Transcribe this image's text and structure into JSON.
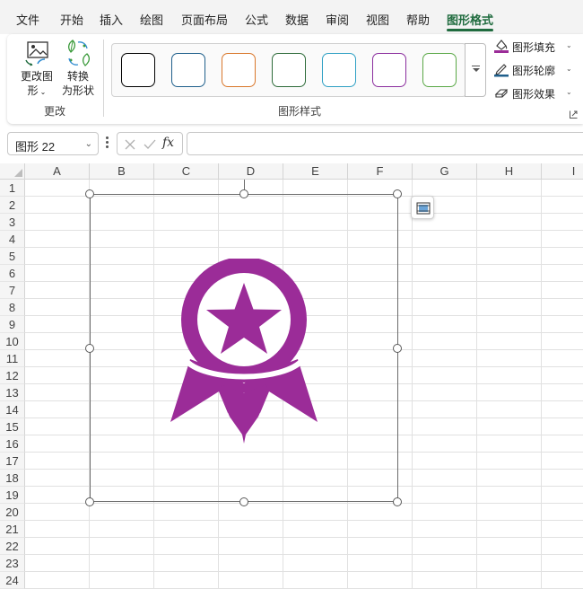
{
  "menu": {
    "tabs": [
      {
        "label": "文件"
      },
      {
        "label": "开始"
      },
      {
        "label": "插入"
      },
      {
        "label": "绘图"
      },
      {
        "label": "页面布局"
      },
      {
        "label": "公式"
      },
      {
        "label": "数据"
      },
      {
        "label": "审阅"
      },
      {
        "label": "视图"
      },
      {
        "label": "帮助"
      },
      {
        "label": "图形格式"
      }
    ],
    "active_tab": "图形格式",
    "accent_color": "#1f6b3e"
  },
  "ribbon": {
    "change_group": {
      "change_graphic_line1": "更改图",
      "change_graphic_line2": "形",
      "convert_line1": "转换",
      "convert_line2": "为形状",
      "label": "更改"
    },
    "styles_group": {
      "label": "图形样式",
      "swatch_colors": [
        "#000000",
        "#1f5f8b",
        "#d9772b",
        "#2e6b3a",
        "#2fa0c4",
        "#8b2e9e",
        "#5aa846"
      ]
    },
    "fill_label": "图形填充",
    "outline_label": "图形轮廓",
    "effects_label": "图形效果",
    "fill_color": "#9b2c98",
    "outline_color": "#1f5f8b"
  },
  "formula_bar": {
    "name_box": "图形 22",
    "fx_label": "fx",
    "formula": ""
  },
  "sheet": {
    "columns": [
      "A",
      "B",
      "C",
      "D",
      "E",
      "F",
      "G",
      "H",
      "I"
    ],
    "rows": [
      "1",
      "2",
      "3",
      "4",
      "5",
      "6",
      "7",
      "8",
      "9",
      "10",
      "11",
      "12",
      "13",
      "14",
      "15",
      "16",
      "17",
      "18",
      "19",
      "20",
      "21",
      "22",
      "23",
      "24"
    ]
  },
  "graphic": {
    "icon": "award-ribbon-icon",
    "fill_color": "#9b2c98"
  }
}
